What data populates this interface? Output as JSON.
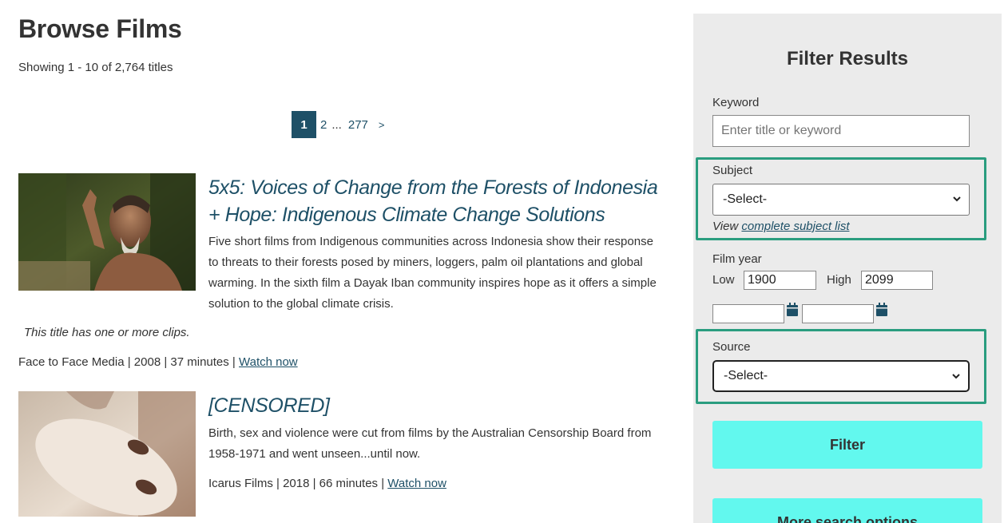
{
  "page": {
    "title": "Browse Films",
    "count": "Showing 1 - 10 of 2,764 titles"
  },
  "pager": {
    "current": "1",
    "page2": "2",
    "ellipsis": "...",
    "last": "277",
    "next": ">"
  },
  "films": [
    {
      "title": "5x5: Voices of Change from the Forests of Indonesia + Hope: Indigenous Climate Change Solutions",
      "description": "Five short films from Indigenous communities across Indonesia show their response to threats to their forests posed by miners, loggers, palm oil plantations and global warming. In the sixth film a Dayak Iban community inspires hope as it offers a simple solution to the global climate crisis.",
      "clips_note": "This title has one or more clips.",
      "meta": "Face to Face Media | 2008 | 37 minutes | ",
      "watch": "Watch now"
    },
    {
      "title": "[CENSORED]",
      "description": "Birth, sex and violence were cut from films by the Australian Censorship Board from 1958-1971 and went unseen...until now.",
      "meta": "Icarus Films | 2018 | 66 minutes | ",
      "watch": "Watch now"
    }
  ],
  "filter": {
    "title": "Filter Results",
    "keyword_label": "Keyword",
    "keyword_placeholder": "Enter title or keyword",
    "subject_label": "Subject",
    "subject_value": "-Select-",
    "view_prefix": "View ",
    "view_link": "complete subject list",
    "year_label": "Film year",
    "low_label": "Low",
    "low_value": "1900",
    "high_label": "High",
    "high_value": "2099",
    "source_label": "Source",
    "source_value": "-Select-",
    "filter_button": "Filter",
    "more_button": "More search options"
  },
  "colors": {
    "accent": "#1e5067",
    "button": "#62f8ee",
    "highlight": "#2a9d7f",
    "sidebar_bg": "#ebebeb"
  },
  "icons": [
    "calendar-icon",
    "chevron-down-icon"
  ]
}
